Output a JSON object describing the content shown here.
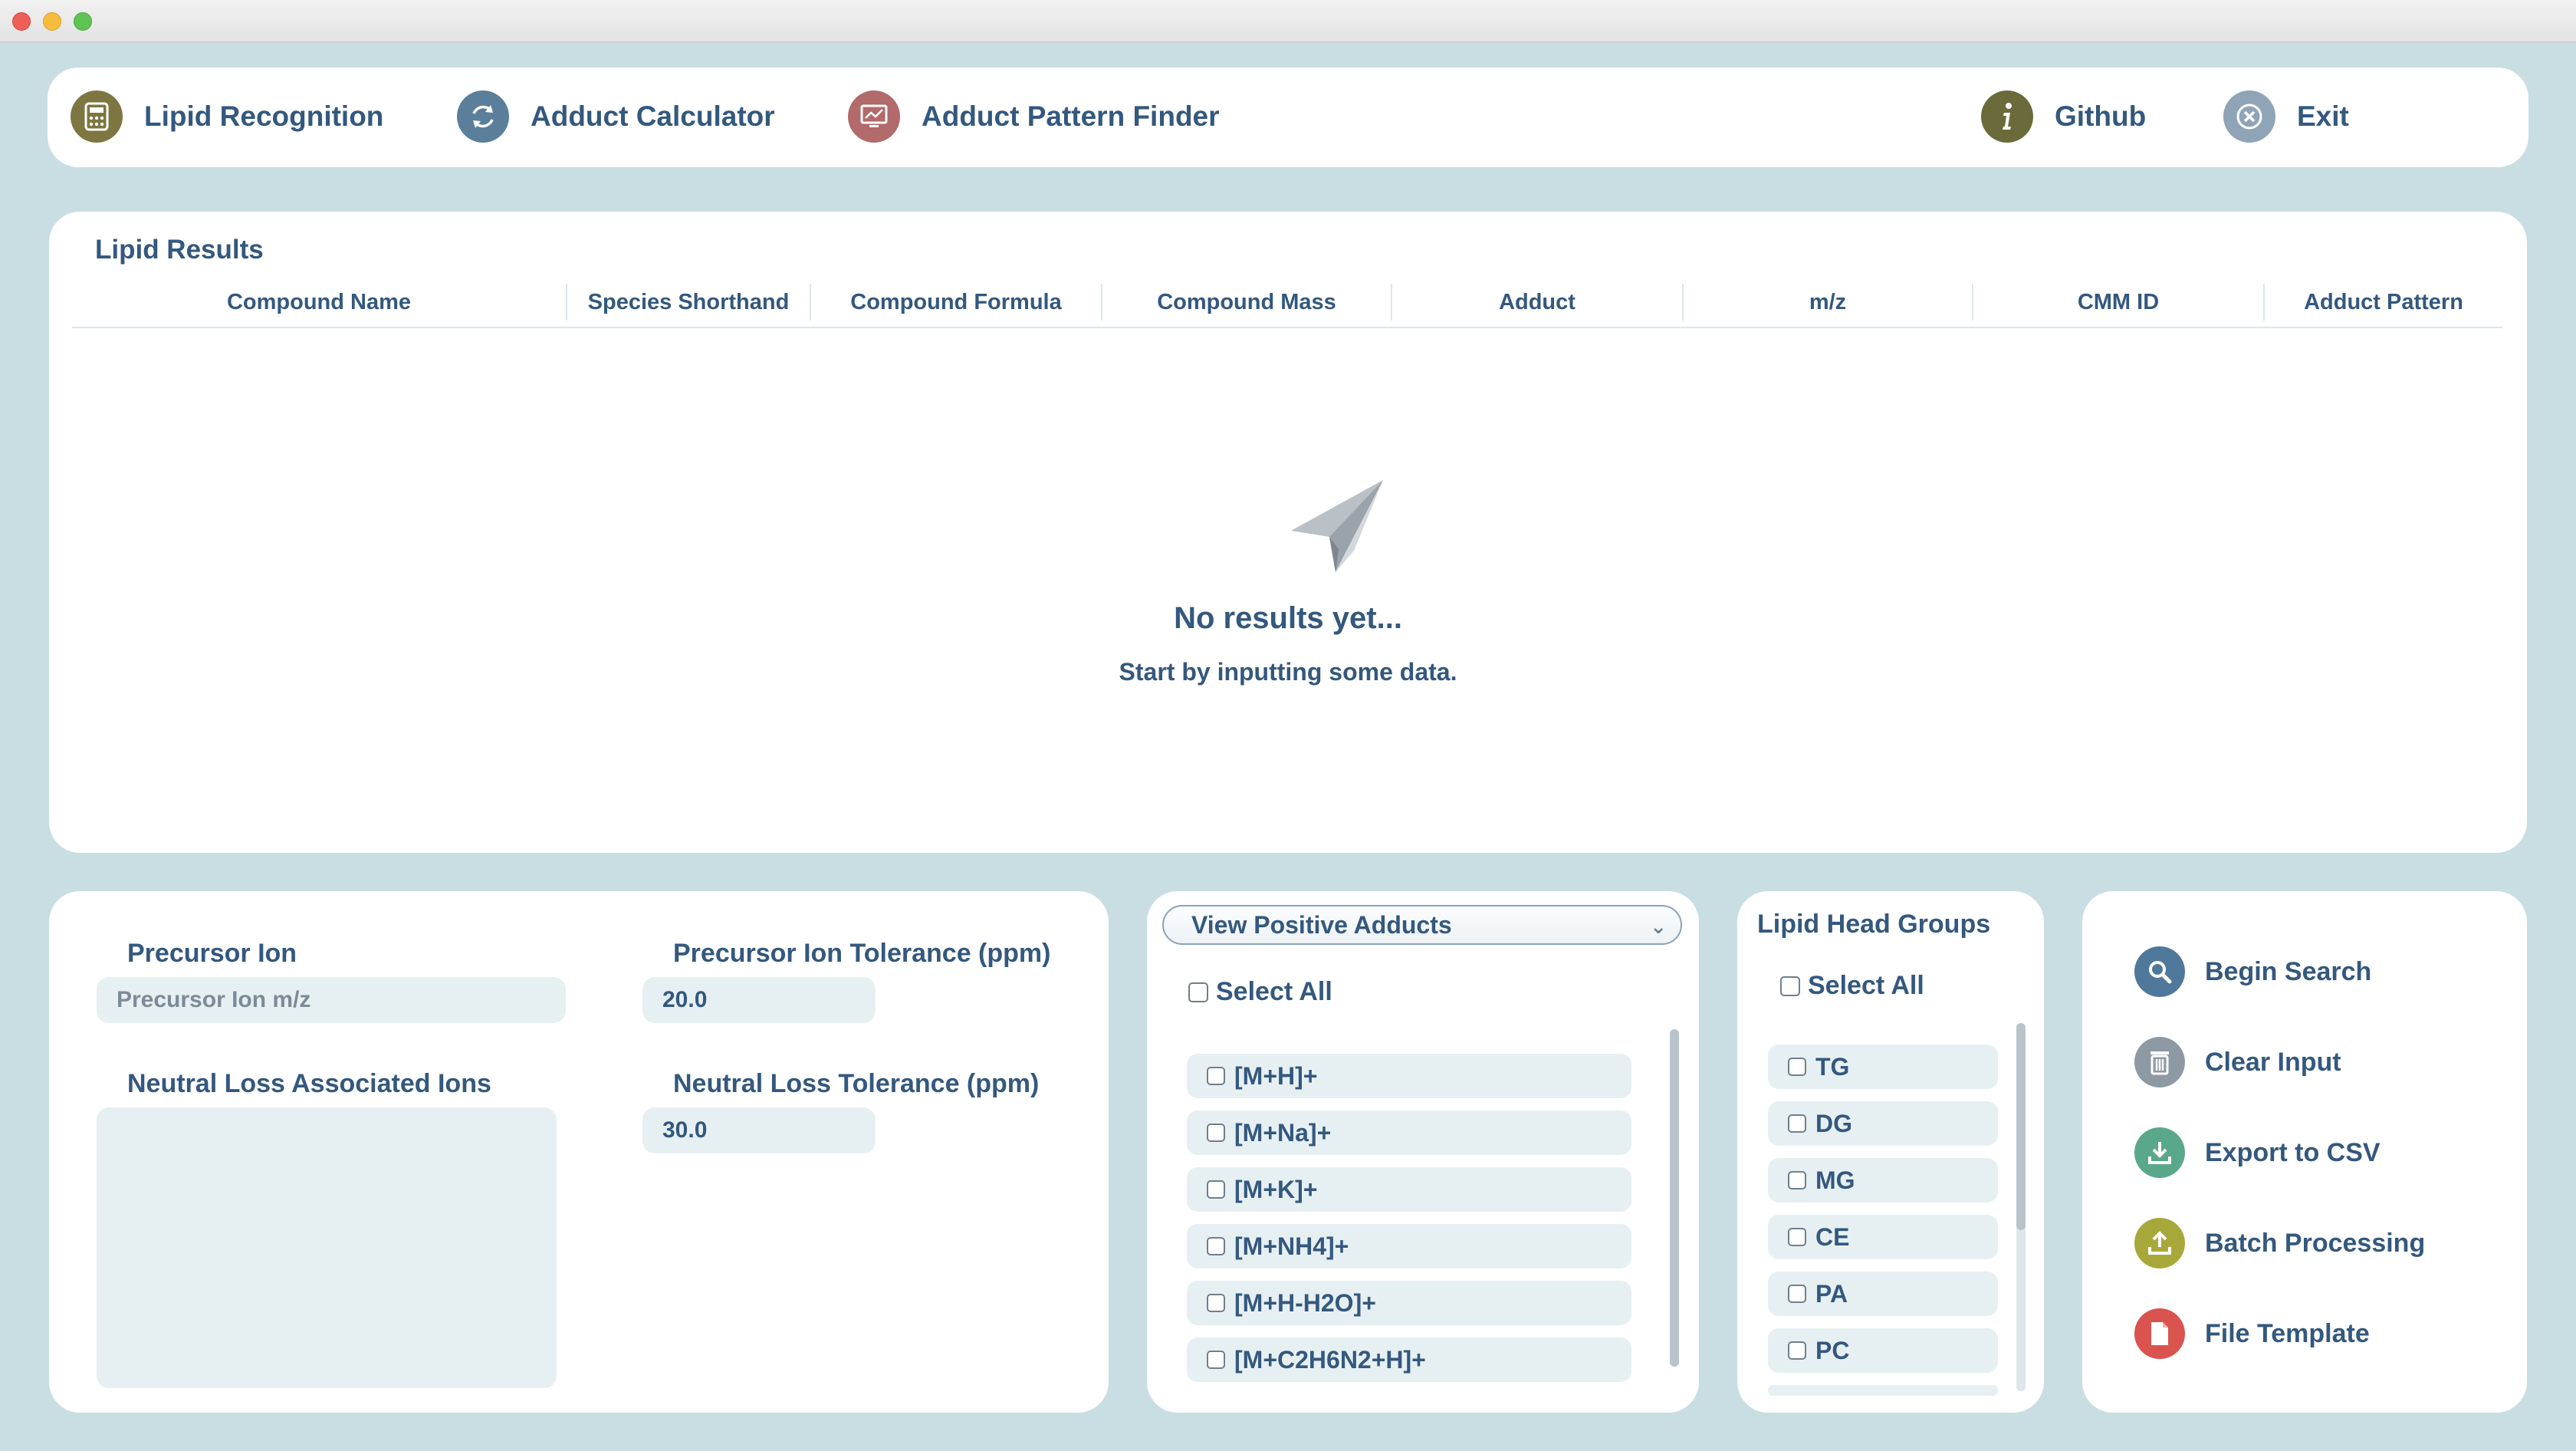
{
  "nav": {
    "items": [
      {
        "label": "Lipid Recognition",
        "icon": "calculator-icon",
        "color": "#7d7640"
      },
      {
        "label": "Adduct Calculator",
        "icon": "refresh-icon",
        "color": "#5b7f9b"
      },
      {
        "label": "Adduct Pattern Finder",
        "icon": "monitor-icon",
        "color": "#b26a6a"
      },
      {
        "label": "Github",
        "icon": "info-icon",
        "color": "#6b6a3a"
      },
      {
        "label": "Exit",
        "icon": "close-icon",
        "color": "#8fa4b6"
      }
    ]
  },
  "results": {
    "title": "Lipid Results",
    "columns": [
      "Compound Name",
      "Species Shorthand",
      "Compound Formula",
      "Compound Mass",
      "Adduct",
      "m/z",
      "CMM ID",
      "Adduct Pattern"
    ],
    "empty_title": "No results yet...",
    "empty_subtitle": "Start by inputting some data."
  },
  "inputs": {
    "precursor_label": "Precursor Ion",
    "precursor_placeholder": "Precursor Ion m/z",
    "precursor_tol_label": "Precursor Ion Tolerance (ppm)",
    "precursor_tol_value": "20.0",
    "neutral_label": "Neutral Loss Associated Ions",
    "neutral_tol_label": "Neutral Loss Tolerance (ppm)",
    "neutral_tol_value": "30.0"
  },
  "adducts": {
    "dropdown": "View Positive Adducts",
    "select_all": "Select All",
    "items": [
      "[M+H]+",
      "[M+Na]+",
      "[M+K]+",
      "[M+NH4]+",
      "[M+H-H2O]+",
      "[M+C2H6N2+H]+"
    ]
  },
  "heads": {
    "title": "Lipid Head Groups",
    "select_all": "Select All",
    "items": [
      "TG",
      "DG",
      "MG",
      "CE",
      "PA",
      "PC"
    ]
  },
  "actions": {
    "items": [
      {
        "label": "Begin Search",
        "icon": "search-icon",
        "color": "#4f789b"
      },
      {
        "label": "Clear Input",
        "icon": "trash-icon",
        "color": "#8e9aa3"
      },
      {
        "label": "Export to CSV",
        "icon": "download-icon",
        "color": "#5aa88a"
      },
      {
        "label": "Batch Processing",
        "icon": "upload-icon",
        "color": "#a8a83a"
      },
      {
        "label": "File Template",
        "icon": "file-icon",
        "color": "#d9534f"
      }
    ]
  }
}
